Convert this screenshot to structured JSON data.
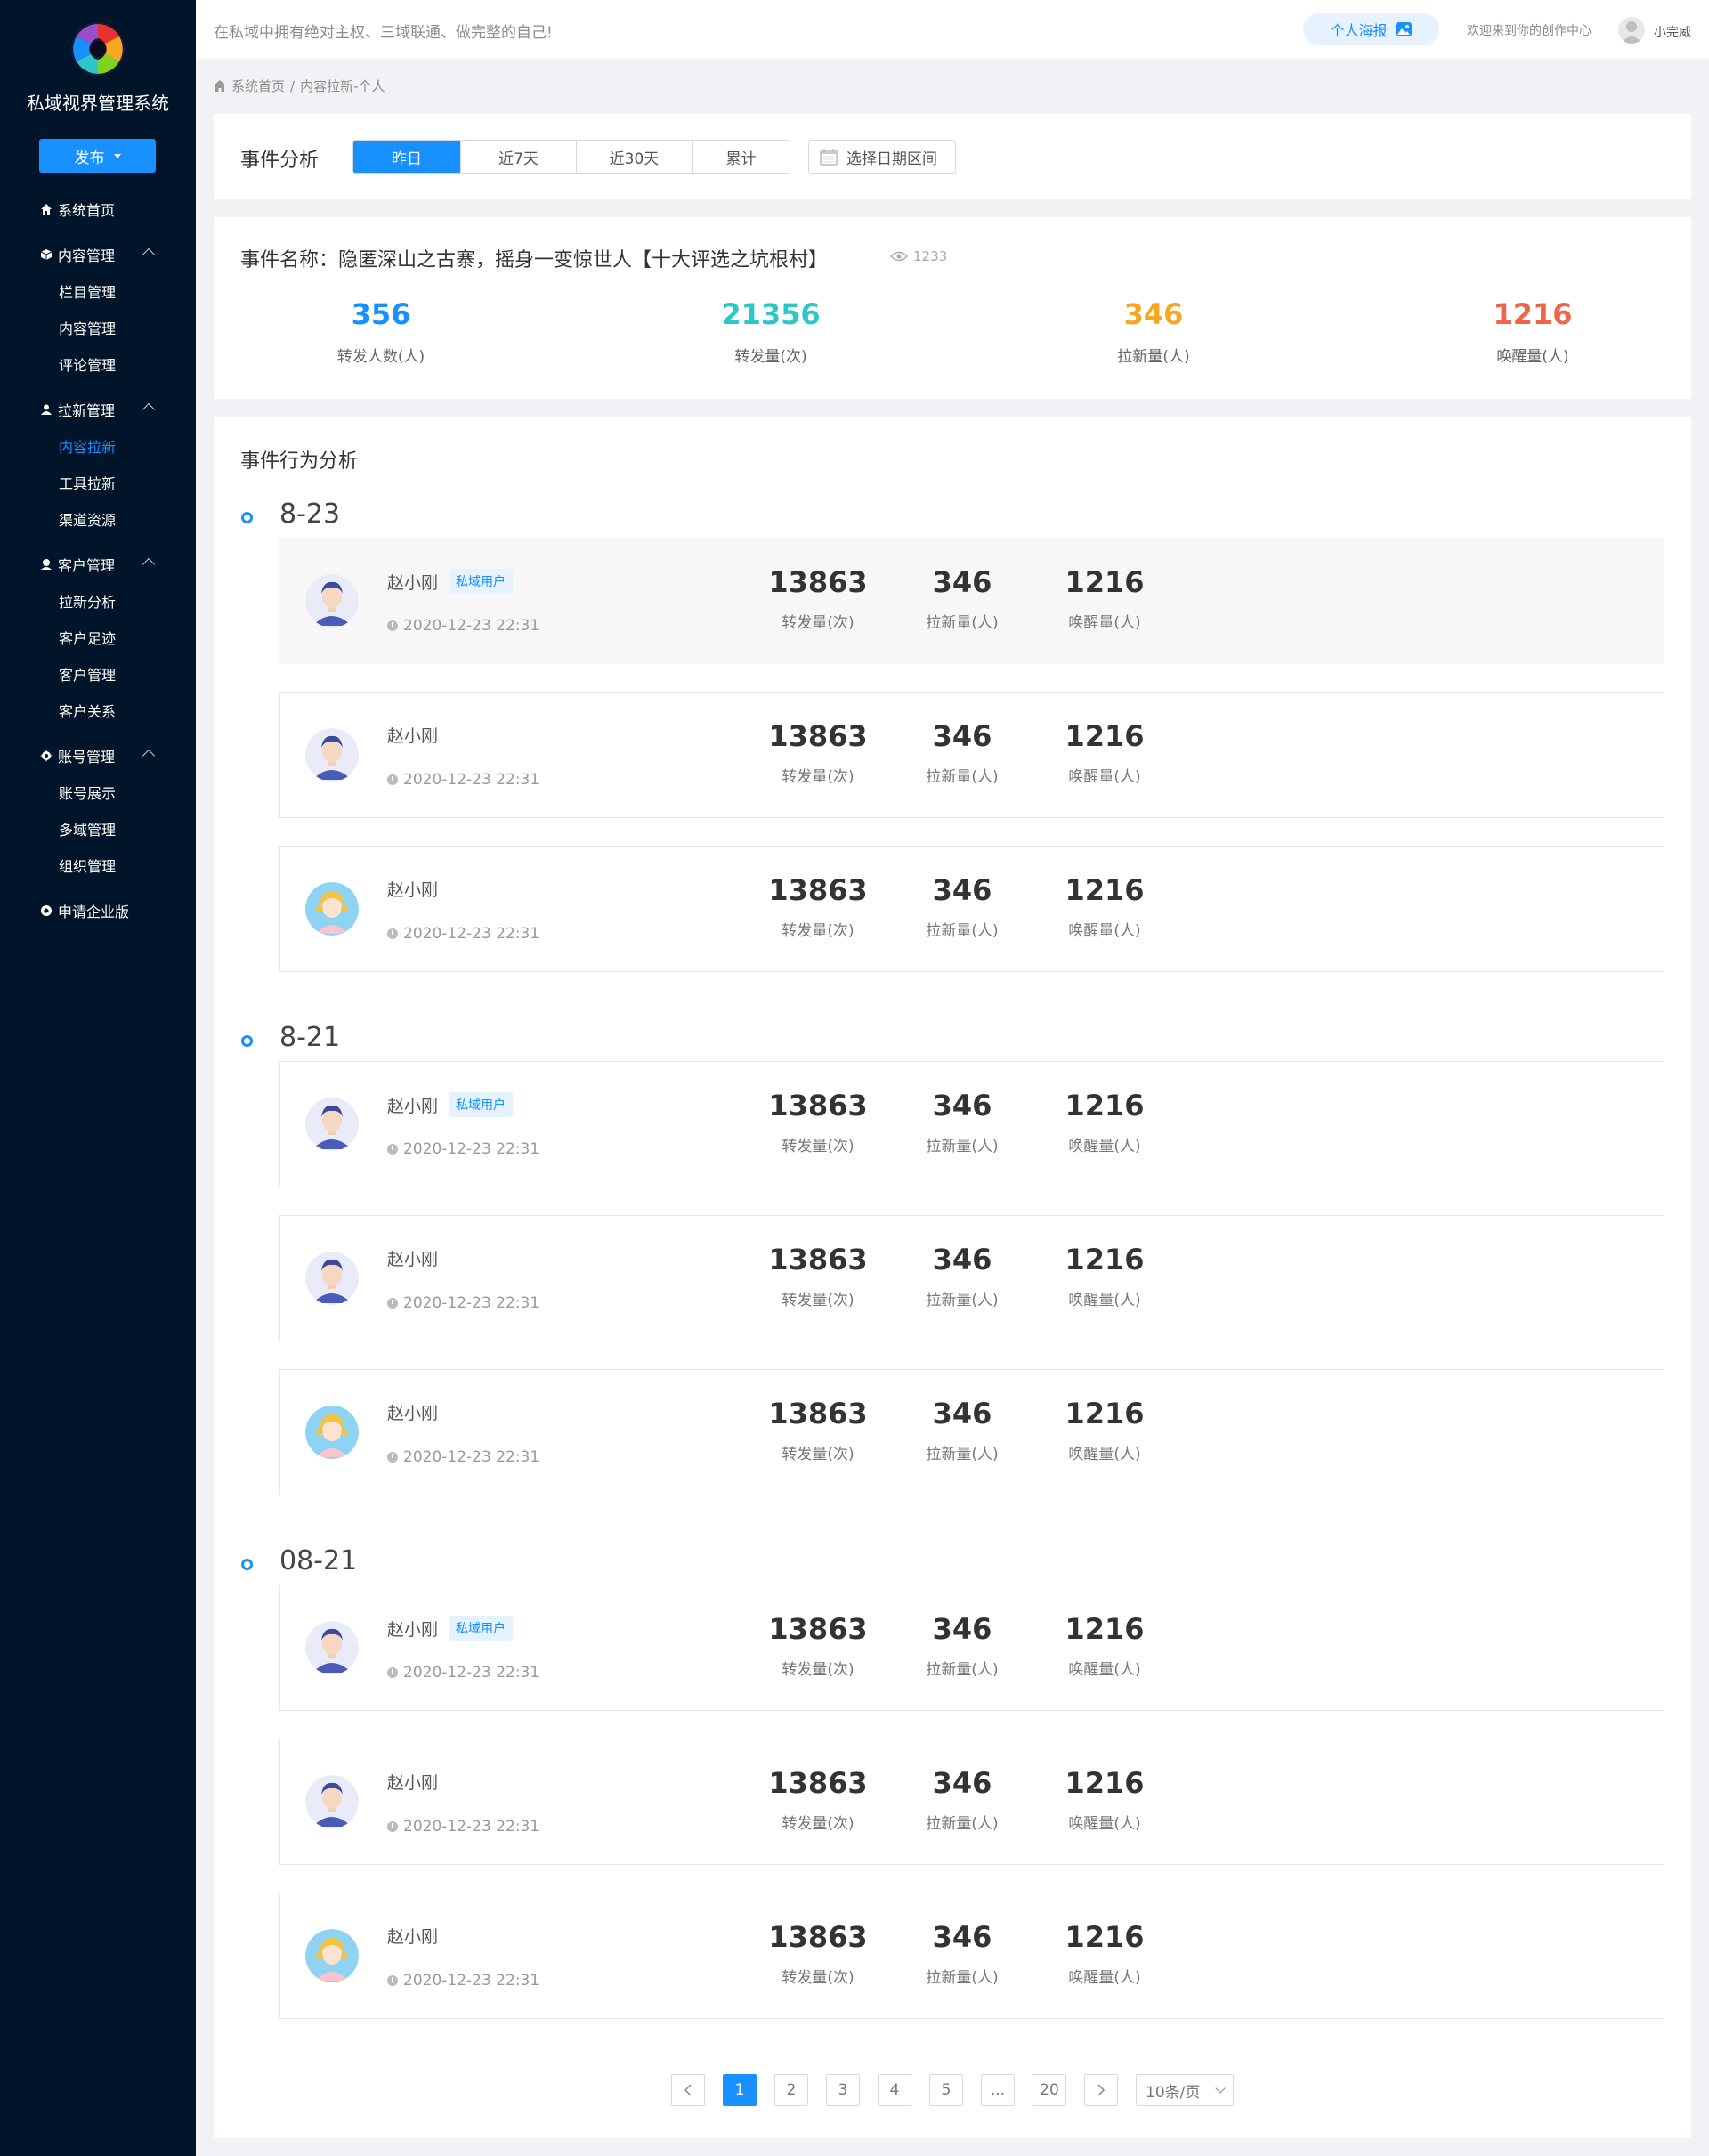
{
  "app": {
    "title": "私域视界管理系统",
    "publish_label": "发布"
  },
  "menu": {
    "home": "系统首页",
    "groups": [
      {
        "label": "内容管理",
        "icon": "cube-icon",
        "items": [
          "栏目管理",
          "内容管理",
          "评论管理"
        ]
      },
      {
        "label": "拉新管理",
        "icon": "user-icon",
        "items": [
          "内容拉新",
          "工具拉新",
          "渠道资源"
        ]
      },
      {
        "label": "客户管理",
        "icon": "users-icon",
        "items": [
          "拉新分析",
          "客户足迹",
          "客户管理",
          "客户关系"
        ]
      },
      {
        "label": "账号管理",
        "icon": "gear-icon",
        "items": [
          "账号展示",
          "多域管理",
          "组织管理"
        ]
      }
    ],
    "enterprise": "申请企业版",
    "active_item": "内容拉新"
  },
  "header": {
    "slogan": "在私域中拥有绝对主权、三域联通、做完整的自己!",
    "poster_label": "个人海报",
    "welcome": "欢迎来到你的创作中心",
    "username": "小完威"
  },
  "breadcrumb": {
    "home": "系统首页",
    "sep": "/",
    "current": "内容拉新-个人"
  },
  "filter": {
    "title": "事件分析",
    "ranges": [
      "昨日",
      "近7天",
      "近30天",
      "累计"
    ],
    "active_range": "昨日",
    "date_picker": "选择日期区间"
  },
  "event": {
    "name": "事件名称：隐匿深山之古寨，摇身一变惊世人【十大评选之坑根村】",
    "views": "1233",
    "stats": [
      {
        "value": "356",
        "label": "转发人数(人)",
        "color": "#1890ff"
      },
      {
        "value": "21356",
        "label": "转发量(次)",
        "color": "#2ec7c9"
      },
      {
        "value": "346",
        "label": "拉新量(人)",
        "color": "#f5a623"
      },
      {
        "value": "1216",
        "label": "唤醒量(人)",
        "color": "#f0654a"
      }
    ]
  },
  "behavior": {
    "title": "事件行为分析",
    "stat_labels": {
      "forward": "转发量(次)",
      "new": "拉新量(人)",
      "wake": "唤醒量(人)"
    },
    "groups": [
      {
        "date": "8-23",
        "rows": [
          {
            "name": "赵小刚",
            "tag": "私域用户",
            "time": "2020-12-23 22:31",
            "forward": "13863",
            "new": "346",
            "wake": "1216",
            "avatar": "male"
          },
          {
            "name": "赵小刚",
            "tag": "",
            "time": "2020-12-23 22:31",
            "forward": "13863",
            "new": "346",
            "wake": "1216",
            "avatar": "male"
          },
          {
            "name": "赵小刚",
            "tag": "",
            "time": "2020-12-23 22:31",
            "forward": "13863",
            "new": "346",
            "wake": "1216",
            "avatar": "female"
          }
        ]
      },
      {
        "date": "8-21",
        "rows": [
          {
            "name": "赵小刚",
            "tag": "私域用户",
            "time": "2020-12-23 22:31",
            "forward": "13863",
            "new": "346",
            "wake": "1216",
            "avatar": "male"
          },
          {
            "name": "赵小刚",
            "tag": "",
            "time": "2020-12-23 22:31",
            "forward": "13863",
            "new": "346",
            "wake": "1216",
            "avatar": "male"
          },
          {
            "name": "赵小刚",
            "tag": "",
            "time": "2020-12-23 22:31",
            "forward": "13863",
            "new": "346",
            "wake": "1216",
            "avatar": "female"
          }
        ]
      },
      {
        "date": "08-21",
        "rows": [
          {
            "name": "赵小刚",
            "tag": "私域用户",
            "time": "2020-12-23 22:31",
            "forward": "13863",
            "new": "346",
            "wake": "1216",
            "avatar": "male"
          },
          {
            "name": "赵小刚",
            "tag": "",
            "time": "2020-12-23 22:31",
            "forward": "13863",
            "new": "346",
            "wake": "1216",
            "avatar": "male"
          },
          {
            "name": "赵小刚",
            "tag": "",
            "time": "2020-12-23 22:31",
            "forward": "13863",
            "new": "346",
            "wake": "1216",
            "avatar": "female"
          }
        ]
      }
    ]
  },
  "pagination": {
    "pages": [
      "1",
      "2",
      "3",
      "4",
      "5",
      "...",
      "20"
    ],
    "current": "1",
    "page_size": "10条/页"
  }
}
